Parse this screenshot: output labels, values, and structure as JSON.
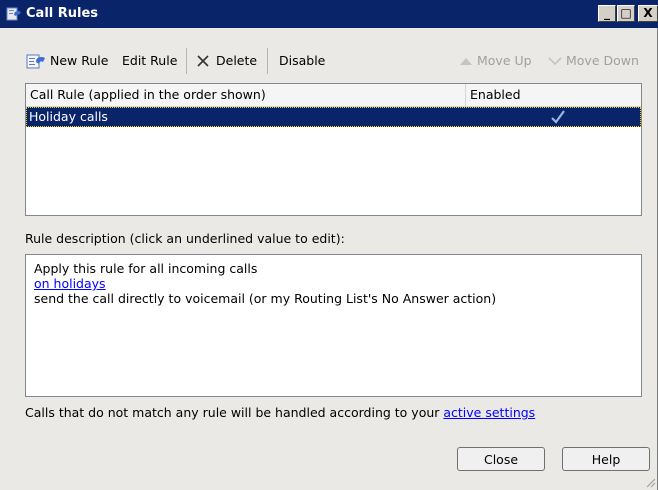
{
  "window": {
    "title": "Call Rules",
    "controls": {
      "minimize": "_",
      "maximize": "□",
      "close": "X"
    }
  },
  "toolbar": {
    "new_rule": "New Rule",
    "edit_rule": "Edit Rule",
    "delete": "Delete",
    "disable": "Disable",
    "move_up": "Move Up",
    "move_down": "Move Down"
  },
  "rules_list": {
    "columns": [
      "Call Rule (applied in the order shown)",
      "Enabled"
    ],
    "rows": [
      {
        "name": "Holiday calls",
        "enabled": true,
        "selected": true
      }
    ]
  },
  "description": {
    "label": "Rule description (click an underlined value to edit):",
    "line1": "Apply this rule for all incoming calls",
    "line2_link": "on holidays",
    "line3": "send the call directly to voicemail (or my Routing List's No Answer action)"
  },
  "footer": {
    "text": "Calls that do not match any rule will be handled according to your ",
    "link": "active settings"
  },
  "buttons": {
    "close": "Close",
    "help": "Help"
  },
  "icons": {
    "app": "phone-rules-icon",
    "new_rule": "new-rule-icon",
    "delete": "delete-x-icon",
    "move_up": "triangle-up-icon",
    "move_down": "chevron-down-icon",
    "enabled_check": "checkmark-icon"
  },
  "colors": {
    "titlebar": "#0a246a",
    "selection": "#0a246a",
    "link": "#0000ff"
  }
}
